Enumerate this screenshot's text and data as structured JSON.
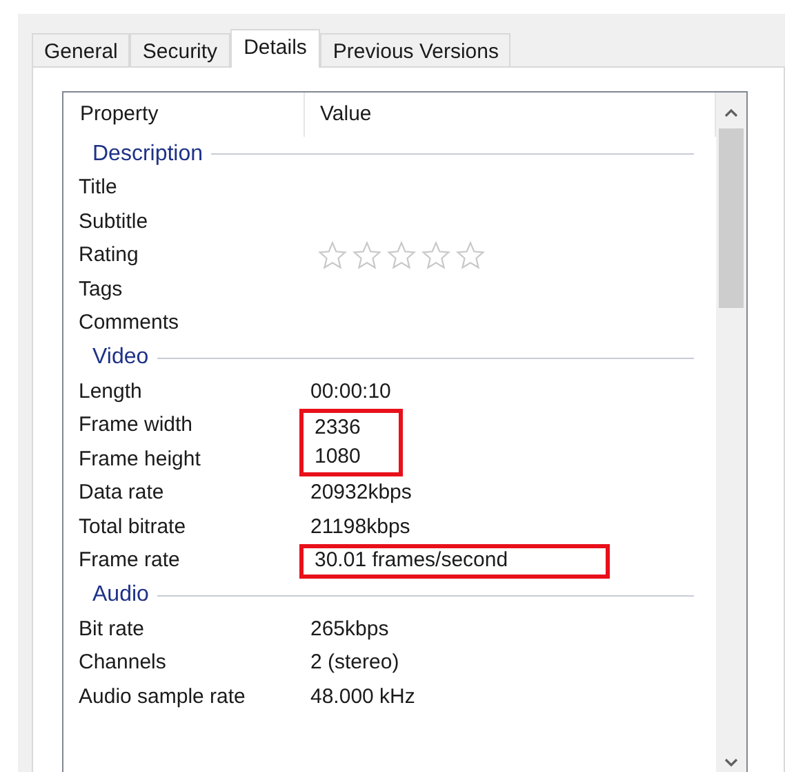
{
  "tabs": [
    {
      "label": "General",
      "selected": false
    },
    {
      "label": "Security",
      "selected": false
    },
    {
      "label": "Details",
      "selected": true
    },
    {
      "label": "Previous Versions",
      "selected": false
    }
  ],
  "columns": [
    "Property",
    "Value"
  ],
  "rows": [
    {
      "kind": "group",
      "label": "Description"
    },
    {
      "kind": "property",
      "name": "Title"
    },
    {
      "kind": "property",
      "name": "Subtitle"
    },
    {
      "kind": "rating",
      "name": "Rating",
      "stars": 0
    },
    {
      "kind": "property",
      "name": "Tags"
    },
    {
      "kind": "property",
      "name": "Comments"
    },
    {
      "kind": "group",
      "label": "Video"
    },
    {
      "kind": "property",
      "name": "Length",
      "value": "00:00:10",
      "marked": false
    },
    {
      "kind": "property",
      "name": "Frame width",
      "value": "2336",
      "marked": true
    },
    {
      "kind": "property",
      "name": "Frame height",
      "value": "1080",
      "marked": true
    },
    {
      "kind": "property",
      "name": "Data rate",
      "value": "20932kbps",
      "marked": false
    },
    {
      "kind": "property",
      "name": "Total bitrate",
      "value": "21198kbps",
      "marked": false
    },
    {
      "kind": "property",
      "name": "Frame rate",
      "value": "30.01 frames/second",
      "marked": true
    },
    {
      "kind": "group",
      "label": "Audio"
    },
    {
      "kind": "property",
      "name": "Bit rate",
      "value": "265kbps",
      "marked": false
    },
    {
      "kind": "property",
      "name": "Channels",
      "value": "2 (stereo)",
      "marked": false
    },
    {
      "kind": "property",
      "name": "Audio sample rate",
      "value": "48.000 kHz",
      "marked": false
    }
  ]
}
